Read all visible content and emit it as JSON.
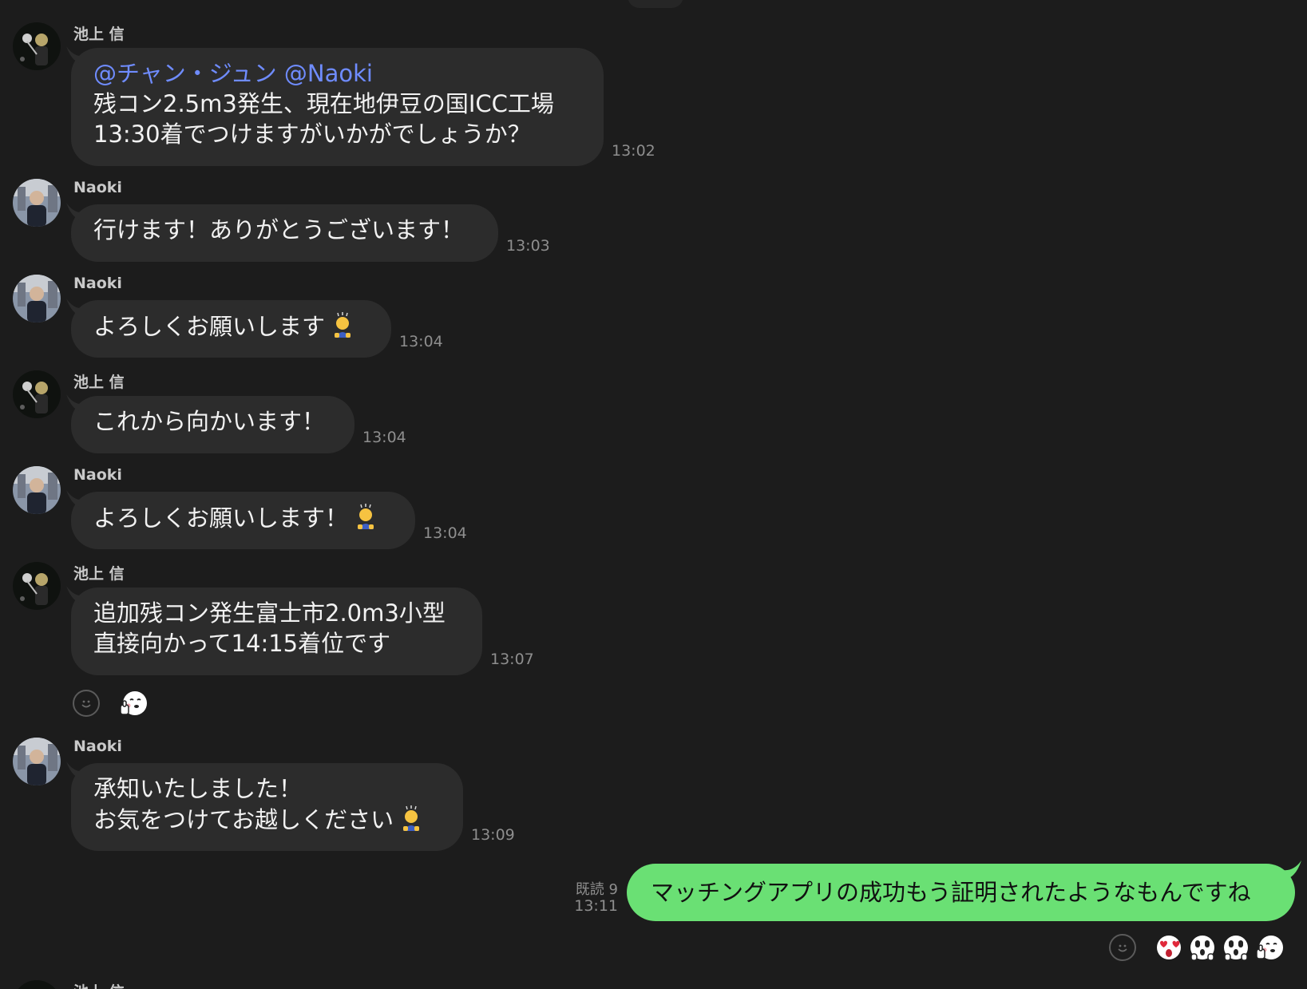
{
  "messages": [
    {
      "sender": "池上 信",
      "mentions": "@チャン・ジュン @Naoki",
      "lines": [
        "残コン2.5m3発生、現在地伊豆の国ICC工場",
        "13:30着でつけますがいかがでしょうか？"
      ],
      "time": "13:02"
    },
    {
      "sender": "Naoki",
      "lines": [
        "行けます！ありがとうございます！"
      ],
      "time": "13:03"
    },
    {
      "sender": "Naoki",
      "lines": [
        "よろしくお願いします"
      ],
      "emoji": "bowing-person-emoji",
      "time": "13:04"
    },
    {
      "sender": "池上 信",
      "lines": [
        "これから向かいます！"
      ],
      "time": "13:04"
    },
    {
      "sender": "Naoki",
      "lines": [
        "よろしくお願いします！"
      ],
      "emoji": "bowing-person-emoji",
      "time": "13:04"
    },
    {
      "sender": "池上 信",
      "lines": [
        "追加残コン発生富士市2.0m3小型",
        "直接向かって14:15着位です"
      ],
      "time": "13:07",
      "reactions": [
        "smiley-reaction-button",
        "thumbs-up-face-reaction"
      ]
    },
    {
      "sender": "Naoki",
      "lines": [
        "承知いたしました！",
        "お気をつけてお越しください"
      ],
      "emoji": "bowing-person-emoji",
      "time": "13:09"
    }
  ],
  "own_message": {
    "text": "マッチングアプリの成功もう証明されたようなもんですね",
    "read_label": "既読 9",
    "time": "13:11",
    "reactions": [
      "smiley-reaction-button",
      "heart-eyes-face-reaction",
      "surprised-face-reaction",
      "surprised-face-reaction",
      "thumbs-up-face-reaction"
    ]
  },
  "partial_next": {
    "sender": "池上 信"
  },
  "colors": {
    "background": "#1c1c1c",
    "incoming_bubble": "#2c2c2c",
    "outgoing_bubble": "#6ae074",
    "mention": "#6f8cff",
    "timestamp": "#8e8e8e"
  }
}
